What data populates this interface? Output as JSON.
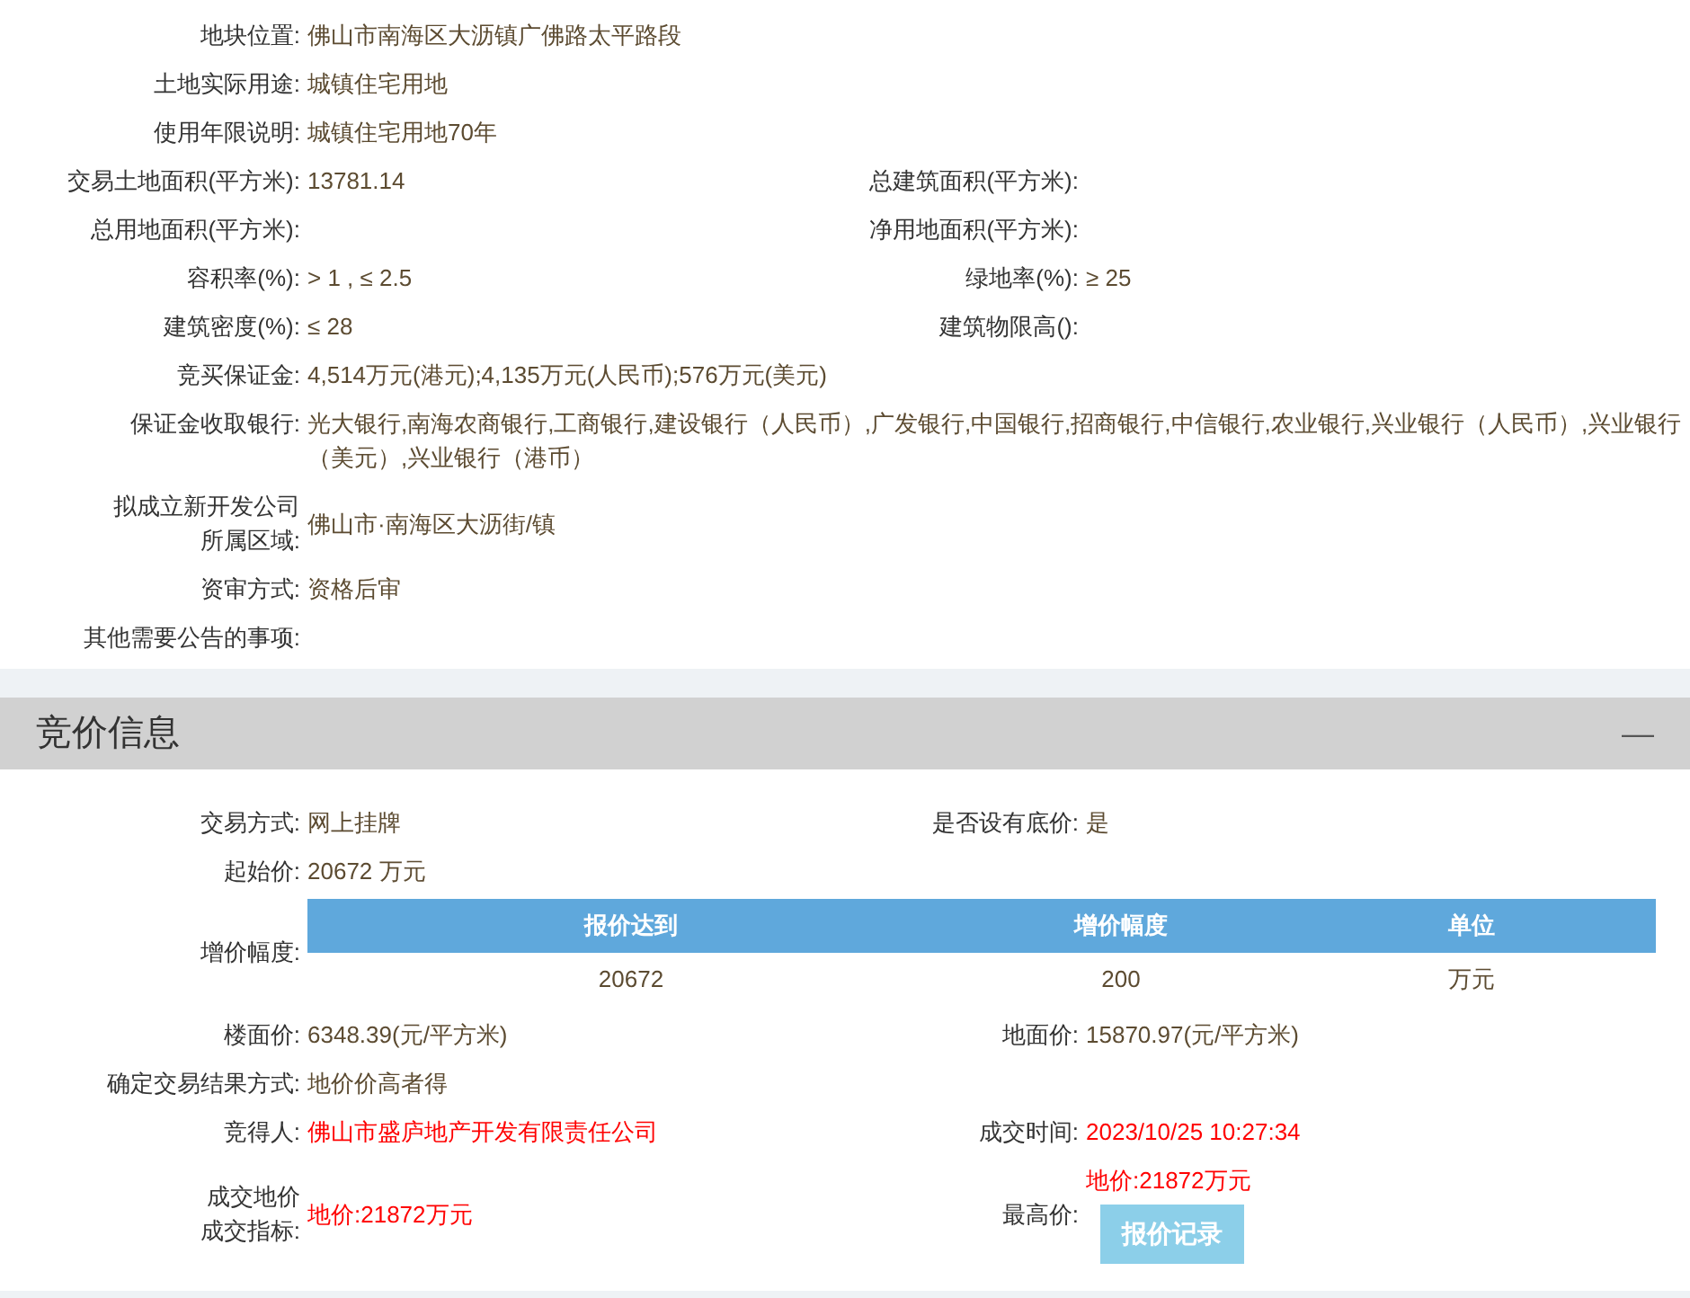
{
  "land_section": {
    "rows": [
      {
        "kind": "fields",
        "fields": [
          {
            "label": "地块位置:",
            "value": "佛山市南海区大沥镇广佛路太平路段"
          }
        ]
      },
      {
        "kind": "fields",
        "fields": [
          {
            "label": "土地实际用途:",
            "value": "城镇住宅用地"
          }
        ]
      },
      {
        "kind": "fields",
        "fields": [
          {
            "label": "使用年限说明:",
            "value": "城镇住宅用地70年"
          }
        ]
      },
      {
        "kind": "fields",
        "fields": [
          {
            "label": "交易土地面积(平方米):",
            "value": "13781.14"
          },
          {
            "label": "总建筑面积(平方米):"
          }
        ]
      },
      {
        "kind": "fields",
        "fields": [
          {
            "label": "总用地面积(平方米):"
          },
          {
            "label": "净用地面积(平方米):"
          }
        ]
      },
      {
        "kind": "fields",
        "fields": [
          {
            "label": "容积率(%):",
            "value": "> 1 , ≤ 2.5"
          },
          {
            "label": "绿地率(%):",
            "value": "≥ 25"
          }
        ]
      },
      {
        "kind": "fields",
        "fields": [
          {
            "label": "建筑密度(%):",
            "value": "≤ 28"
          },
          {
            "label": "建筑物限高():"
          }
        ]
      },
      {
        "kind": "fields",
        "fields": [
          {
            "label": "竞买保证金:",
            "value": "4,514万元(港元);4,135万元(人民币);576万元(美元)"
          }
        ]
      },
      {
        "kind": "fields",
        "fields": [
          {
            "label": "保证金收取银行:",
            "value": "光大银行,南海农商银行,工商银行,建设银行（人民币）,广发银行,中国银行,招商银行,中信银行,农业银行,兴业银行（人民币）,兴业银行（美元）,兴业银行（港币）"
          }
        ]
      },
      {
        "kind": "fields",
        "fields": [
          {
            "label_lines": [
              "拟成立新开发公司",
              "所属区域:"
            ],
            "value": "佛山市·南海区大沥街/镇"
          }
        ]
      },
      {
        "kind": "fields",
        "fields": [
          {
            "label": "资审方式:",
            "value": "资格后审"
          }
        ]
      },
      {
        "kind": "fields",
        "fields": [
          {
            "label": "其他需要公告的事项:"
          }
        ]
      }
    ]
  },
  "bidding_section": {
    "title": "竞价信息",
    "collapse_icon": "—",
    "rows": [
      {
        "kind": "fields",
        "fields": [
          {
            "label": "交易方式:",
            "value": "网上挂牌"
          },
          {
            "label": "是否设有底价:",
            "value": "是"
          }
        ]
      },
      {
        "kind": "fields",
        "fields": [
          {
            "label": "起始价:",
            "value": "20672 万元"
          }
        ]
      },
      {
        "kind": "table",
        "label": "增价幅度:",
        "columns": [
          "报价达到",
          "增价幅度",
          "单位"
        ],
        "rows": [
          [
            "20672",
            "200",
            "万元"
          ]
        ]
      },
      {
        "kind": "fields",
        "fields": [
          {
            "label": "楼面价:",
            "value": "6348.39(元/平方米)"
          },
          {
            "label": "地面价:",
            "value": "15870.97(元/平方米)"
          }
        ]
      },
      {
        "kind": "fields",
        "fields": [
          {
            "label": "确定交易结果方式:",
            "value": "地价价高者得"
          }
        ]
      },
      {
        "kind": "fields",
        "fields": [
          {
            "label": "竞得人:",
            "value": "佛山市盛庐地产开发有限责任公司",
            "emphasis": true
          },
          {
            "label": "成交时间:",
            "value": "2023/10/25 10:27:34",
            "emphasis": true
          }
        ]
      },
      {
        "kind": "fields",
        "fields": [
          {
            "label_lines": [
              "成交地价",
              "成交指标:"
            ],
            "value": "地价:21872万元",
            "emphasis": true
          },
          {
            "label": "最高价:",
            "value": "地价:21872万元",
            "emphasis": true,
            "button": "报价记录"
          }
        ]
      }
    ]
  }
}
